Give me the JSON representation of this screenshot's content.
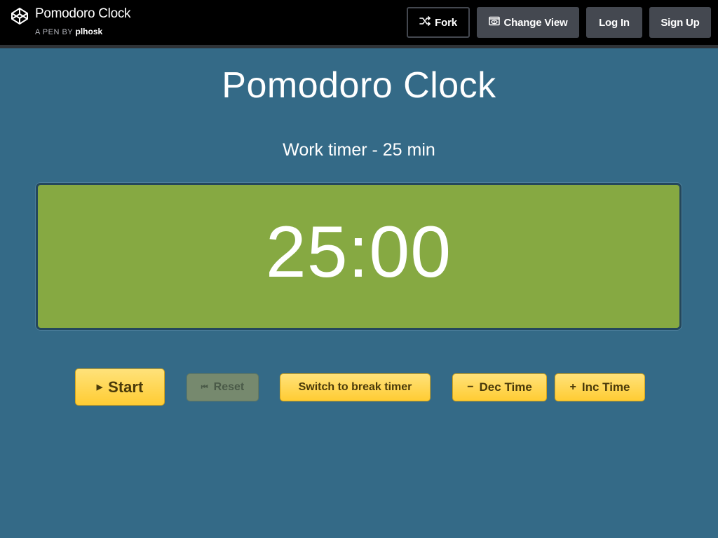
{
  "header": {
    "pen_title": "Pomodoro Clock",
    "by_prefix": "A PEN BY",
    "author": "plhosk",
    "buttons": {
      "fork": "Fork",
      "change_view": "Change View",
      "log_in": "Log In",
      "sign_up": "Sign Up"
    }
  },
  "app": {
    "title": "Pomodoro Clock",
    "subtitle": "Work timer - 25 min",
    "time": "25:00",
    "buttons": {
      "start": "Start",
      "reset": "Reset",
      "switch": "Switch to break timer",
      "dec": "Dec Time",
      "inc": "Inc Time"
    }
  },
  "colors": {
    "background": "#346a87",
    "clock": "#86a942",
    "button": "#ffd34d",
    "reset_disabled": "#76896e"
  },
  "icons": {
    "logo": "codepen-logo-icon",
    "fork": "fork-icon",
    "change_view": "eye-icon",
    "start": "play-icon",
    "reset": "skip-back-icon"
  }
}
